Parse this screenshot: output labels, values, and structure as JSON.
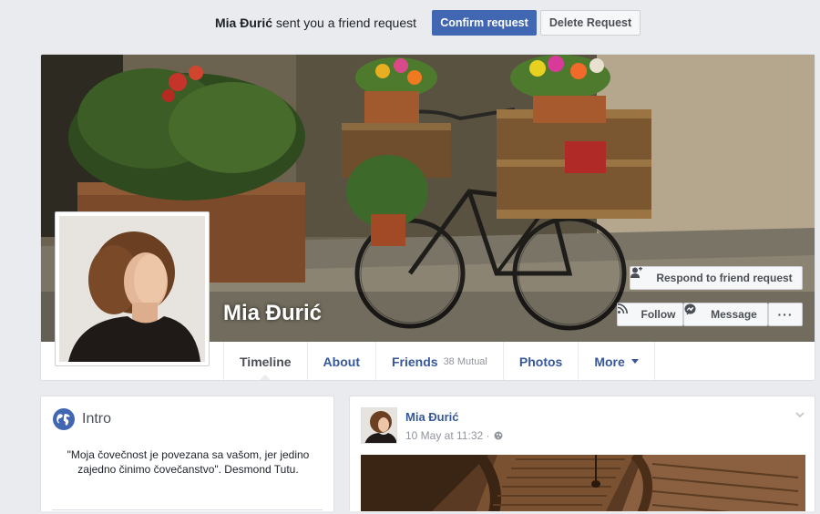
{
  "friend_request": {
    "name": "Mia Đurić",
    "message": "sent you a friend request",
    "confirm_label": "Confirm request",
    "delete_label": "Delete Request"
  },
  "profile": {
    "name": "Mia Đurić",
    "respond_label": "Respond to friend request",
    "follow_label": "Follow",
    "message_label": "Message",
    "more_label": "···"
  },
  "tabs": [
    {
      "label": "Timeline"
    },
    {
      "label": "About"
    },
    {
      "label": "Friends",
      "sub": "38 Mutual"
    },
    {
      "label": "Photos"
    },
    {
      "label": "More"
    }
  ],
  "intro": {
    "title": "Intro",
    "bio": "\"Moja čovečnost je povezana sa vašom, jer jedino zajedno činimo čovečanstvo\". Desmond Tutu."
  },
  "post": {
    "author": "Mia Đurić",
    "time": "10 May at 11:32 ·"
  },
  "colors": {
    "primary": "#4267b2",
    "link": "#365899",
    "background": "#e9ebee"
  },
  "icons": [
    "add-friend-icon",
    "rss-icon",
    "messenger-icon",
    "globe-icon",
    "public-icon",
    "chevron-down-icon"
  ]
}
